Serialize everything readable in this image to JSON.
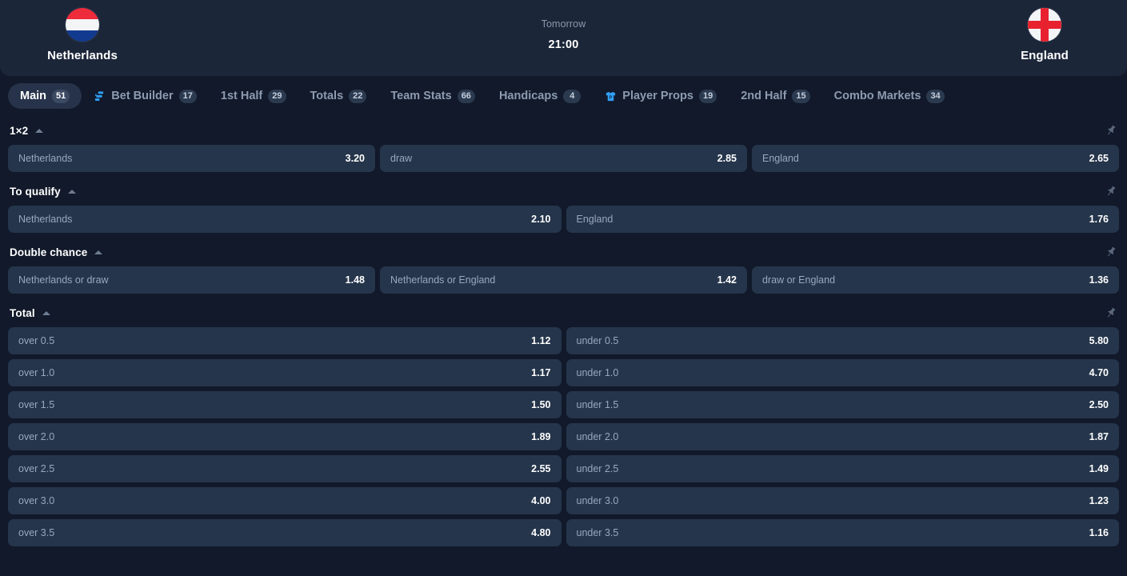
{
  "header": {
    "home_team": "Netherlands",
    "away_team": "England",
    "day": "Tomorrow",
    "time": "21:00",
    "home_flag_icon": "netherlands-flag-icon",
    "away_flag_icon": "england-flag-icon"
  },
  "tabs": [
    {
      "label": "Main",
      "count": "51",
      "active": true,
      "icon": null
    },
    {
      "label": "Bet Builder",
      "count": "17",
      "active": false,
      "icon": "bet-builder-icon"
    },
    {
      "label": "1st Half",
      "count": "29",
      "active": false,
      "icon": null
    },
    {
      "label": "Totals",
      "count": "22",
      "active": false,
      "icon": null
    },
    {
      "label": "Team Stats",
      "count": "66",
      "active": false,
      "icon": null
    },
    {
      "label": "Handicaps",
      "count": "4",
      "active": false,
      "icon": null
    },
    {
      "label": "Player Props",
      "count": "19",
      "active": false,
      "icon": "player-props-jersey-icon"
    },
    {
      "label": "2nd Half",
      "count": "15",
      "active": false,
      "icon": null
    },
    {
      "label": "Combo Markets",
      "count": "34",
      "active": false,
      "icon": null
    }
  ],
  "markets": [
    {
      "title": "1×2",
      "columns": 3,
      "rows": [
        [
          {
            "label": "Netherlands",
            "odds": "3.20"
          },
          {
            "label": "draw",
            "odds": "2.85"
          },
          {
            "label": "England",
            "odds": "2.65"
          }
        ]
      ]
    },
    {
      "title": "To qualify",
      "columns": 2,
      "rows": [
        [
          {
            "label": "Netherlands",
            "odds": "2.10"
          },
          {
            "label": "England",
            "odds": "1.76"
          }
        ]
      ]
    },
    {
      "title": "Double chance",
      "columns": 3,
      "rows": [
        [
          {
            "label": "Netherlands or draw",
            "odds": "1.48"
          },
          {
            "label": "Netherlands or England",
            "odds": "1.42"
          },
          {
            "label": "draw or England",
            "odds": "1.36"
          }
        ]
      ]
    },
    {
      "title": "Total",
      "columns": 2,
      "rows": [
        [
          {
            "label": "over 0.5",
            "odds": "1.12"
          },
          {
            "label": "under 0.5",
            "odds": "5.80"
          }
        ],
        [
          {
            "label": "over 1.0",
            "odds": "1.17"
          },
          {
            "label": "under 1.0",
            "odds": "4.70"
          }
        ],
        [
          {
            "label": "over 1.5",
            "odds": "1.50"
          },
          {
            "label": "under 1.5",
            "odds": "2.50"
          }
        ],
        [
          {
            "label": "over 2.0",
            "odds": "1.89"
          },
          {
            "label": "under 2.0",
            "odds": "1.87"
          }
        ],
        [
          {
            "label": "over 2.5",
            "odds": "2.55"
          },
          {
            "label": "under 2.5",
            "odds": "1.49"
          }
        ],
        [
          {
            "label": "over 3.0",
            "odds": "4.00"
          },
          {
            "label": "under 3.0",
            "odds": "1.23"
          }
        ],
        [
          {
            "label": "over 3.5",
            "odds": "4.80"
          },
          {
            "label": "under 3.5",
            "odds": "1.16"
          }
        ]
      ]
    }
  ],
  "icons": {
    "collapse_chevron": "chevron-up-icon",
    "pin": "pin-icon"
  },
  "colors": {
    "page_bg": "#11192a",
    "header_bg": "#1c2639",
    "odd_bg": "#25354b",
    "accent_blue": "#2f9ef5",
    "muted_text": "#9aa8bc"
  }
}
